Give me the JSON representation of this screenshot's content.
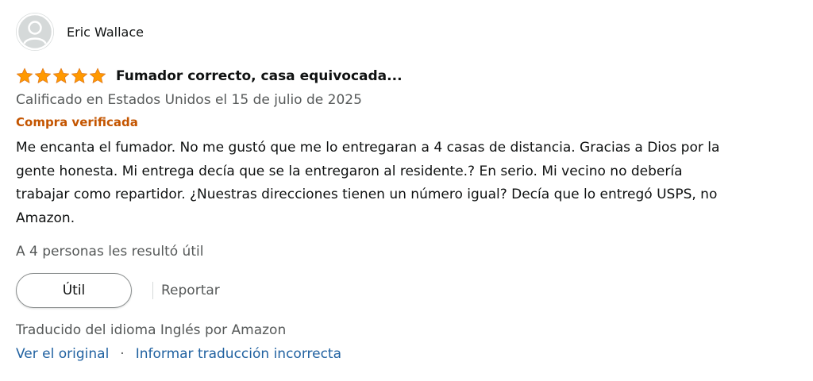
{
  "reviewer": {
    "name": "Eric Wallace"
  },
  "review": {
    "rating": 5,
    "rating_max": 5,
    "title": "Fumador correcto, casa equivocada...",
    "date_line": "Calificado en Estados Unidos el 15 de julio de 2025",
    "verified_label": "Compra verificada",
    "body_lines": [
      "Me encanta el fumador. No me gustó que me lo entregaran a 4 casas de distancia. Gracias a Dios por la",
      "gente honesta. Mi entrega decía que se la entregaron al residente.? En serio. Mi vecino no debería",
      "trabajar como repartidor. ¿Nuestras direcciones tienen un número igual? Decía que lo entregó USPS, no",
      "Amazon."
    ],
    "helpful_count": "A 4 personas les resultó útil"
  },
  "actions": {
    "helpful_label": "Útil",
    "report_label": "Reportar"
  },
  "translation": {
    "note": "Traducido del idioma Inglés por Amazon",
    "separator": "·",
    "view_original": "Ver el original",
    "report_translation": "Informar traducción incorrecta"
  },
  "icons": {
    "avatar": "user-silhouette-icon",
    "star": "star-icon"
  },
  "colors": {
    "star": "#ff9900",
    "verified": "#c45500",
    "link": "#2162a1",
    "muted": "#565959",
    "text": "#0f1111"
  }
}
